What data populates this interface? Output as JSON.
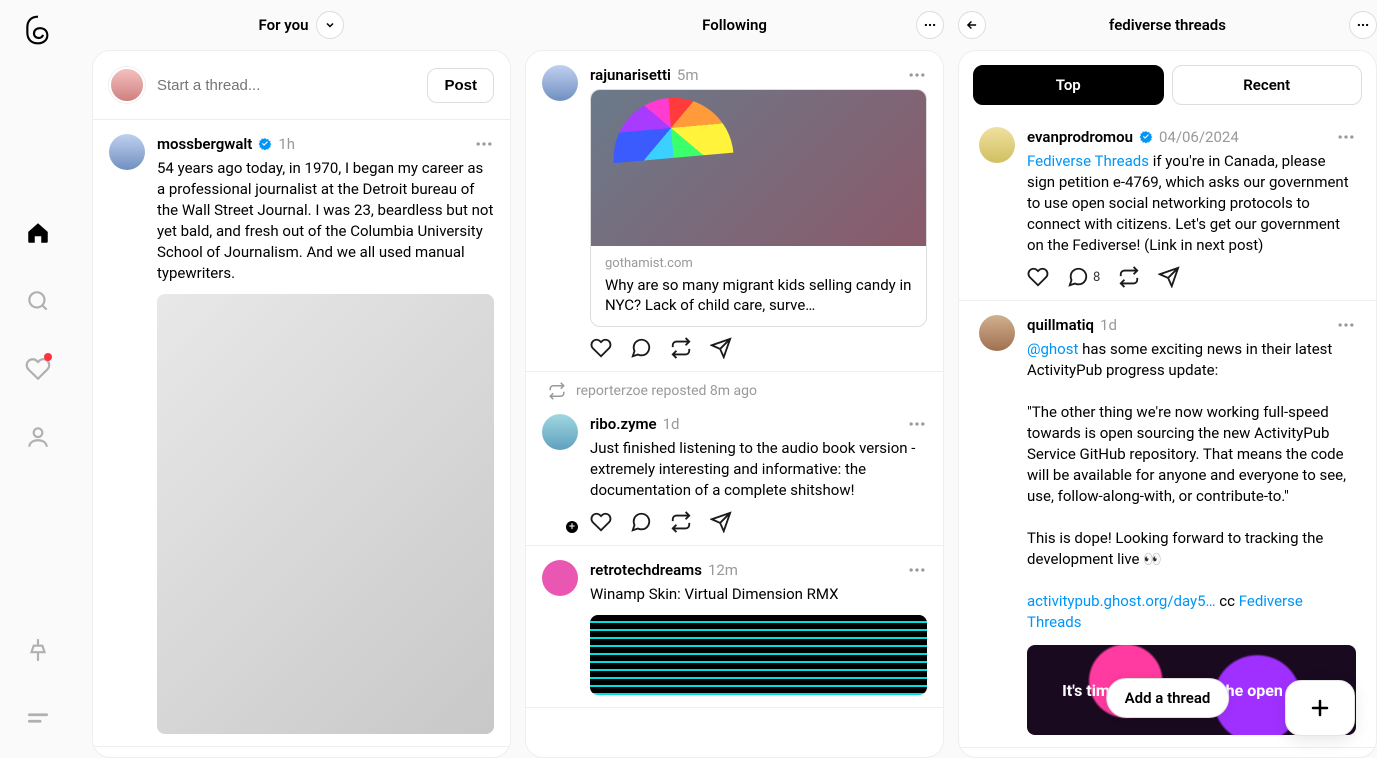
{
  "columns": {
    "forYou": {
      "title": "For you"
    },
    "following": {
      "title": "Following"
    },
    "fediverse": {
      "title": "fediverse threads"
    }
  },
  "composer": {
    "placeholder": "Start a thread...",
    "postLabel": "Post"
  },
  "tabs": {
    "top": "Top",
    "recent": "Recent"
  },
  "addThreadLabel": "Add a thread",
  "posts": {
    "mossberg": {
      "user": "mossbergwalt",
      "time": "1h",
      "text": "54 years ago today, in 1970, I began my career as a professional journalist at the Detroit bureau of the Wall Street Journal. I was 23, beardless but not yet bald, and fresh out of the Columbia University School of Journalism. And we all used manual typewriters."
    },
    "raju": {
      "user": "rajunarisetti",
      "time": "5m",
      "linkDomain": "gothamist.com",
      "linkTitle": "Why are so many migrant kids selling candy in NYC? Lack of child care, surve…"
    },
    "repostLine": "reporterzoe reposted 8m ago",
    "ribo": {
      "user": "ribo.zyme",
      "time": "1d",
      "text": "Just finished listening to the audio book version - extremely interesting and informative: the documentation of a complete shitshow!"
    },
    "retro": {
      "user": "retrotechdreams",
      "time": "12m",
      "text": "Winamp Skin: Virtual Dimension RMX"
    },
    "evan": {
      "user": "evanprodromou",
      "time": "04/06/2024",
      "linkTag": "Fediverse Threads",
      "text": " if you're in Canada, please sign petition e-4769, which asks our government to use open social networking protocols to connect with citizens. Let's get our government on the Fediverse! (Link in next post)",
      "replyCount": "8"
    },
    "quill": {
      "user": "quillmatiq",
      "time": "1d",
      "mention": "@ghost",
      "p1": " has some exciting news in their latest ActivityPub progress update:",
      "p2": "\"The other thing we're now working full-speed towards is open sourcing the new ActivityPub Service GitHub repository. That means the code will be available for anyone and everyone to see, use, follow-along-with, or contribute-to.\"",
      "p3": "This is dope! Looking forward to tracking the development live 👀",
      "link1": "activitypub.ghost.org/day5…",
      "cc": " cc ",
      "link2": "Fediverse Threads",
      "bannerText": "It's time to bring back the open web."
    }
  }
}
